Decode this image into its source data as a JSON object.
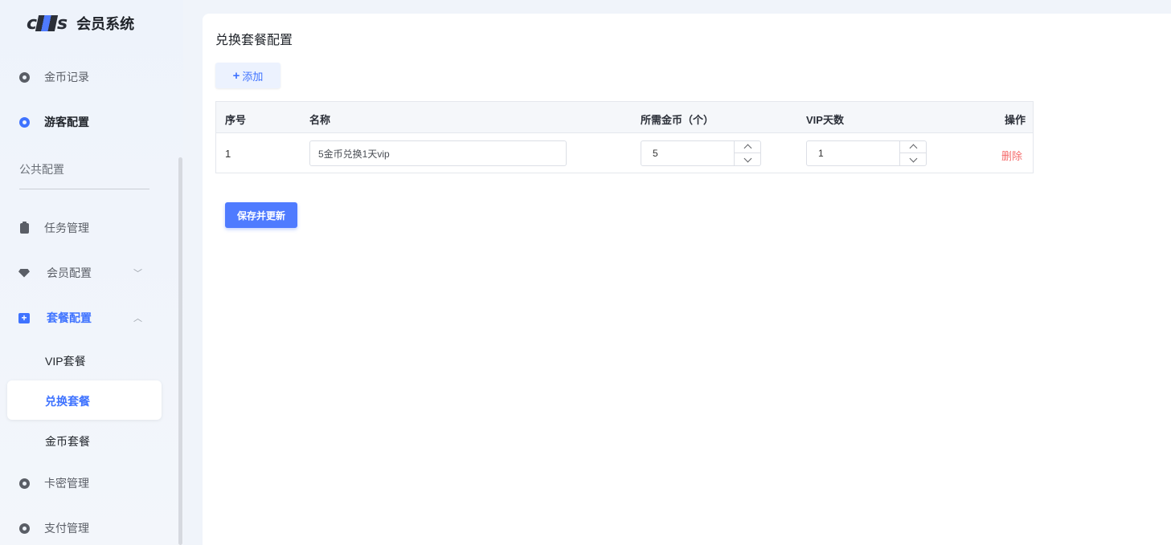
{
  "brand": {
    "logo_left": "c",
    "logo_right": "s",
    "name": "会员系统"
  },
  "sidebar": {
    "items": [
      {
        "label": "金币记录",
        "icon": "coin-record-icon"
      },
      {
        "label": "游客配置",
        "icon": "guest-config-icon"
      },
      {
        "label": "任务管理",
        "icon": "clipboard-icon"
      },
      {
        "label": "会员配置",
        "icon": "gem-icon"
      },
      {
        "label": "套餐配置",
        "icon": "package-icon"
      },
      {
        "label": "卡密管理",
        "icon": "card-key-icon"
      },
      {
        "label": "支付管理",
        "icon": "payment-icon"
      }
    ],
    "section_title": "公共配置",
    "package_sub": [
      {
        "label": "VIP套餐"
      },
      {
        "label": "兑换套餐"
      },
      {
        "label": "金币套餐"
      }
    ]
  },
  "page": {
    "title": "兑换套餐配置",
    "add_label": "添加",
    "save_label": "保存并更新"
  },
  "table": {
    "headers": {
      "index": "序号",
      "name": "名称",
      "coins": "所需金币（个）",
      "vip_days": "VIP天数",
      "action": "操作"
    },
    "rows": [
      {
        "index": "1",
        "name": "5金币兑换1天vip",
        "coins": "5",
        "vip_days": "1",
        "delete": "删除"
      }
    ]
  },
  "colors": {
    "accent": "#3f73ff",
    "danger": "#f56c6c"
  }
}
